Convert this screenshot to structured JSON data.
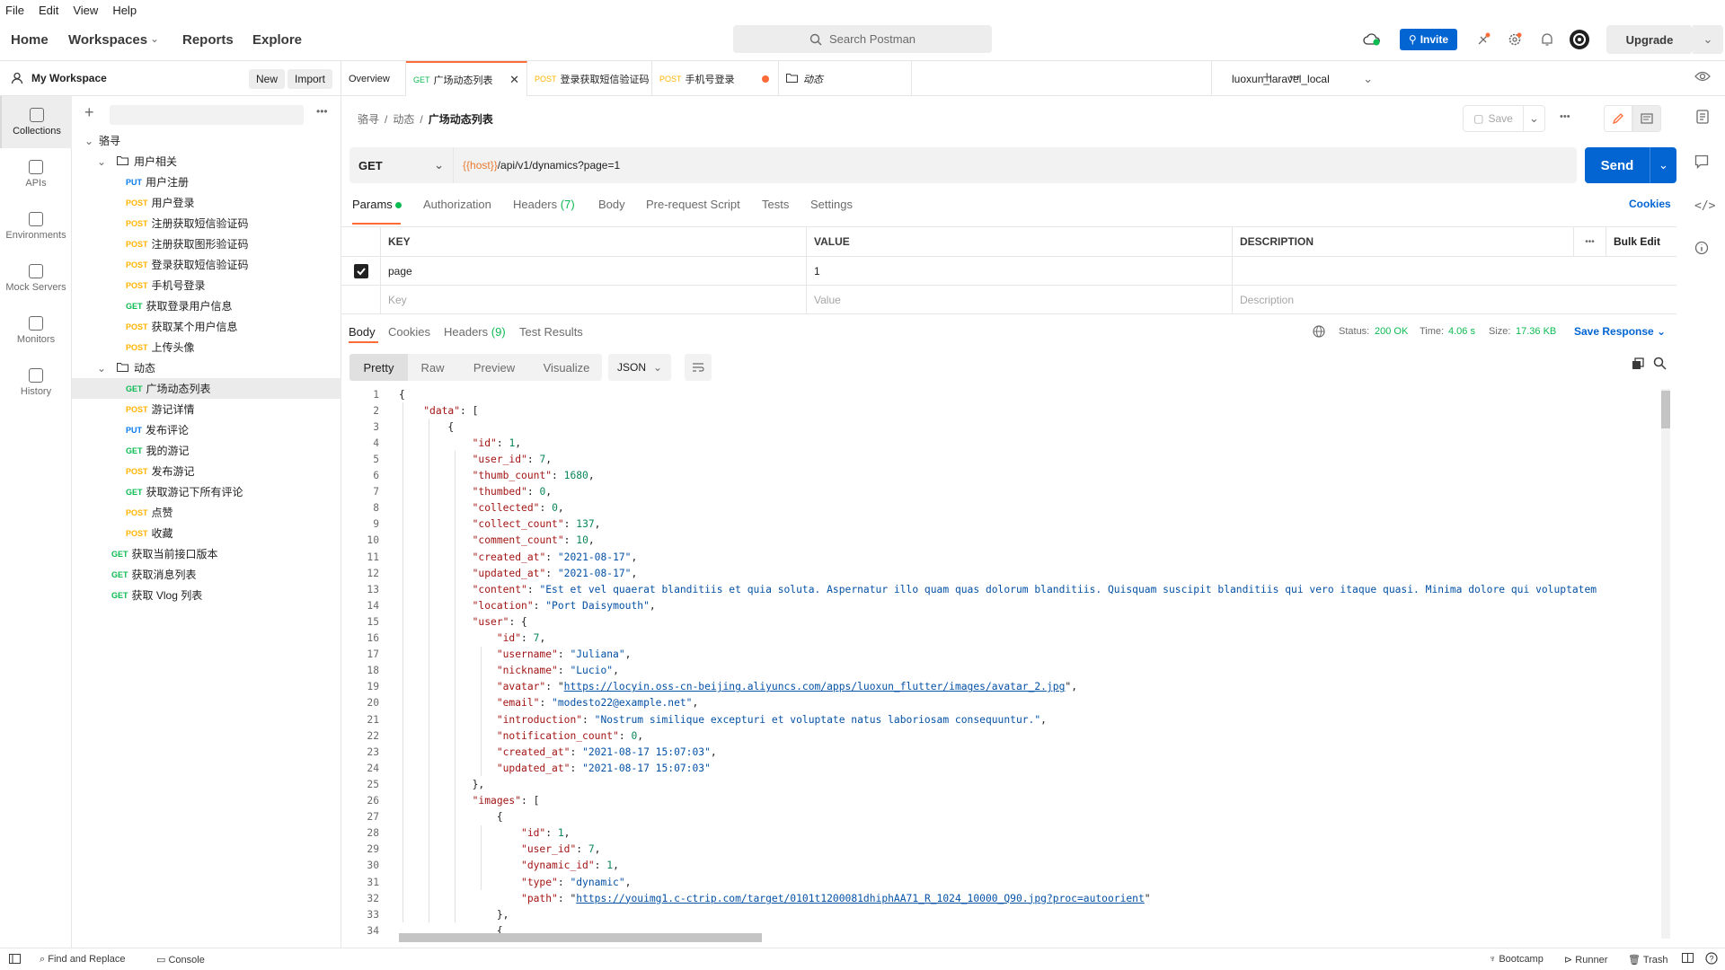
{
  "menu": [
    "File",
    "Edit",
    "View",
    "Help"
  ],
  "nav": {
    "home": "Home",
    "workspaces": "Workspaces",
    "reports": "Reports",
    "explore": "Explore"
  },
  "search": {
    "placeholder": "Search Postman"
  },
  "header": {
    "invite": "Invite",
    "upgrade": "Upgrade"
  },
  "workspace": {
    "name": "My Workspace",
    "new": "New",
    "import": "Import"
  },
  "rail": [
    {
      "label": "Collections",
      "icon": "collections-icon"
    },
    {
      "label": "APIs",
      "icon": "apis-icon"
    },
    {
      "label": "Environments",
      "icon": "environments-icon"
    },
    {
      "label": "Mock Servers",
      "icon": "mock-servers-icon"
    },
    {
      "label": "Monitors",
      "icon": "monitors-icon"
    },
    {
      "label": "History",
      "icon": "history-icon"
    }
  ],
  "tree": [
    {
      "type": "collection",
      "label": "骆寻",
      "depth": 0
    },
    {
      "type": "folder",
      "label": "用户相关",
      "depth": 1
    },
    {
      "type": "request",
      "method": "PUT",
      "label": "用户注册",
      "depth": 2
    },
    {
      "type": "request",
      "method": "POST",
      "label": "用户登录",
      "depth": 2
    },
    {
      "type": "request",
      "method": "POST",
      "label": "注册获取短信验证码",
      "depth": 2
    },
    {
      "type": "request",
      "method": "POST",
      "label": "注册获取图形验证码",
      "depth": 2
    },
    {
      "type": "request",
      "method": "POST",
      "label": "登录获取短信验证码",
      "depth": 2
    },
    {
      "type": "request",
      "method": "POST",
      "label": "手机号登录",
      "depth": 2
    },
    {
      "type": "request",
      "method": "GET",
      "label": "获取登录用户信息",
      "depth": 2
    },
    {
      "type": "request",
      "method": "POST",
      "label": "获取某个用户信息",
      "depth": 2
    },
    {
      "type": "request",
      "method": "POST",
      "label": "上传头像",
      "depth": 2
    },
    {
      "type": "folder",
      "label": "动态",
      "depth": 1
    },
    {
      "type": "request",
      "method": "GET",
      "label": "广场动态列表",
      "depth": 2,
      "selected": true
    },
    {
      "type": "request",
      "method": "POST",
      "label": "游记详情",
      "depth": 2
    },
    {
      "type": "request",
      "method": "PUT",
      "label": "发布评论",
      "depth": 2
    },
    {
      "type": "request",
      "method": "GET",
      "label": "我的游记",
      "depth": 2
    },
    {
      "type": "request",
      "method": "POST",
      "label": "发布游记",
      "depth": 2
    },
    {
      "type": "request",
      "method": "GET",
      "label": "获取游记下所有评论",
      "depth": 2
    },
    {
      "type": "request",
      "method": "POST",
      "label": "点赞",
      "depth": 2
    },
    {
      "type": "request",
      "method": "POST",
      "label": "收藏",
      "depth": 2
    },
    {
      "type": "request",
      "method": "GET",
      "label": "获取当前接口版本",
      "depth": 1
    },
    {
      "type": "request",
      "method": "GET",
      "label": "获取消息列表",
      "depth": 1
    },
    {
      "type": "request",
      "method": "GET",
      "label": "获取 Vlog 列表",
      "depth": 1
    }
  ],
  "tabs": [
    {
      "label": "Overview"
    },
    {
      "method": "GET",
      "label": "广场动态列表",
      "active": true
    },
    {
      "method": "POST",
      "label": "登录获取短信验证码"
    },
    {
      "method": "POST",
      "label": "手机号登录",
      "unsaved": true
    },
    {
      "label": "动态",
      "folder": true
    }
  ],
  "environment": "luoxun_laravel_local",
  "breadcrumb": [
    "骆寻",
    "动态",
    "广场动态列表"
  ],
  "save": "Save",
  "request": {
    "method": "GET",
    "url_var": "{{host}}",
    "url_rest": "/api/v1/dynamics?page=1",
    "send": "Send"
  },
  "request_tabs": {
    "params": "Params",
    "authorization": "Authorization",
    "headers": "Headers",
    "headers_count": "(7)",
    "body": "Body",
    "prerequest": "Pre-request Script",
    "tests": "Tests",
    "settings": "Settings",
    "cookies": "Cookies"
  },
  "params": {
    "headers": {
      "key": "KEY",
      "value": "VALUE",
      "description": "DESCRIPTION",
      "bulk": "Bulk Edit"
    },
    "row": {
      "key": "page",
      "value": "1",
      "checked": true
    },
    "placeholder": {
      "key": "Key",
      "value": "Value",
      "description": "Description"
    }
  },
  "response_tabs": {
    "body": "Body",
    "cookies": "Cookies",
    "headers": "Headers",
    "headers_count": "(9)",
    "tests": "Test Results"
  },
  "response_meta": {
    "status_label": "Status:",
    "status": "200 OK",
    "time_label": "Time:",
    "time": "4.06 s",
    "size_label": "Size:",
    "size": "17.36 KB",
    "save_response": "Save Response"
  },
  "view_modes": [
    "Pretty",
    "Raw",
    "Preview",
    "Visualize"
  ],
  "format": "JSON",
  "code_lines": [
    "{",
    "    \"data\": [",
    "        {",
    "            \"id\": 1,",
    "            \"user_id\": 7,",
    "            \"thumb_count\": 1680,",
    "            \"thumbed\": 0,",
    "            \"collected\": 0,",
    "            \"collect_count\": 137,",
    "            \"comment_count\": 10,",
    "            \"created_at\": \"2021-08-17\",",
    "            \"updated_at\": \"2021-08-17\",",
    "            \"content\": \"Est et vel quaerat blanditiis et quia soluta. Aspernatur illo quam quas dolorum blanditiis. Quisquam suscipit blanditiis qui vero itaque quasi. Minima dolore qui voluptatem",
    "            \"location\": \"Port Daisymouth\",",
    "            \"user\": {",
    "                \"id\": 7,",
    "                \"username\": \"Juliana\",",
    "                \"nickname\": \"Lucio\",",
    "                \"avatar\": \"https://locyin.oss-cn-beijing.aliyuncs.com/apps/luoxun_flutter/images/avatar_2.jpg\",",
    "                \"email\": \"modesto22@example.net\",",
    "                \"introduction\": \"Nostrum similique excepturi et voluptate natus laboriosam consequuntur.\",",
    "                \"notification_count\": 0,",
    "                \"created_at\": \"2021-08-17 15:07:03\",",
    "                \"updated_at\": \"2021-08-17 15:07:03\"",
    "            },",
    "            \"images\": [",
    "                {",
    "                    \"id\": 1,",
    "                    \"user_id\": 7,",
    "                    \"dynamic_id\": 1,",
    "                    \"type\": \"dynamic\",",
    "                    \"path\": \"https://youimg1.c-ctrip.com/target/0101t1200081dhiphAA71_R_1024_10000_Q90.jpg?proc=autoorient\"",
    "                },",
    "                {"
  ],
  "statusbar": {
    "find": "Find and Replace",
    "console": "Console",
    "bootcamp": "Bootcamp",
    "runner": "Runner",
    "trash": "Trash"
  }
}
